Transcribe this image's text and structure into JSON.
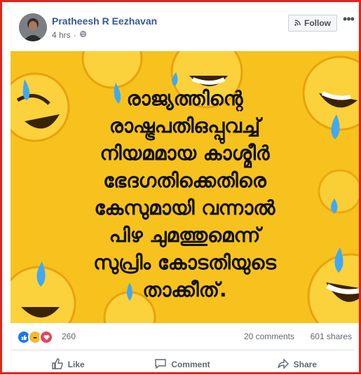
{
  "post": {
    "author": "Pratheesh R Eezhavan",
    "time": "4 hrs",
    "follow_label": "Follow",
    "more_label": "•••",
    "image_text_lines": [
      "രാജ്യത്തിന്റെ",
      "രാഷ്ട്രപതിഒപ്പുവച്ച്",
      "നിയമമായ കാശ്മീർ",
      "ഭേദഗതിക്കെതിരെ",
      "കേസുമായി വന്നാൽ",
      "പിഴ ചുമത്തുമെന്ന്",
      "സുപ്രിം കോടതിയുടെ",
      "താക്കീത്."
    ]
  },
  "stats": {
    "reaction_count": "260",
    "comments": "20 comments",
    "shares": "601 shares"
  },
  "actions": {
    "like": "Like",
    "comment": "Comment",
    "share": "Share"
  },
  "colors": {
    "border": "#e3231b",
    "link": "#365899",
    "image_bg": "#f7c21d",
    "like": "#1877f2",
    "haha": "#f7b928",
    "love": "#e9425a"
  },
  "icons": [
    "globe-icon",
    "rss-icon",
    "like-reaction-icon",
    "haha-reaction-icon",
    "love-reaction-icon",
    "thumbs-up-icon",
    "comment-icon",
    "share-icon"
  ]
}
